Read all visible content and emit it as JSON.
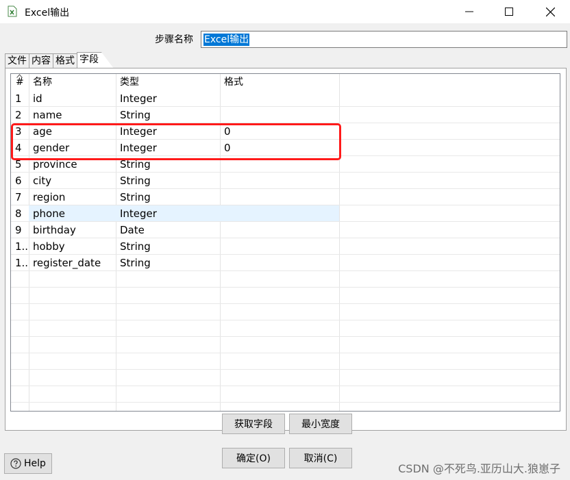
{
  "window": {
    "title": "Excel输出",
    "icon": "excel-file-icon"
  },
  "step": {
    "label": "步骤名称",
    "value": "Excel输出"
  },
  "tabs": [
    {
      "label": "文件"
    },
    {
      "label": "内容"
    },
    {
      "label": "格式"
    },
    {
      "label": "字段"
    }
  ],
  "table": {
    "headers": {
      "num": "#",
      "name": "名称",
      "type": "类型",
      "format": "格式"
    },
    "rows": [
      {
        "num": "1",
        "name": "id",
        "type": "Integer",
        "format": ""
      },
      {
        "num": "2",
        "name": "name",
        "type": "String",
        "format": ""
      },
      {
        "num": "3",
        "name": "age",
        "type": "Integer",
        "format": "0"
      },
      {
        "num": "4",
        "name": "gender",
        "type": "Integer",
        "format": "0"
      },
      {
        "num": "5",
        "name": "province",
        "type": "String",
        "format": ""
      },
      {
        "num": "6",
        "name": "city",
        "type": "String",
        "format": ""
      },
      {
        "num": "7",
        "name": "region",
        "type": "String",
        "format": ""
      },
      {
        "num": "8",
        "name": "phone",
        "type": "Integer",
        "format": ""
      },
      {
        "num": "9",
        "name": "birthday",
        "type": "Date",
        "format": ""
      },
      {
        "num": "1..",
        "name": "hobby",
        "type": "String",
        "format": ""
      },
      {
        "num": "1..",
        "name": "register_date",
        "type": "String",
        "format": ""
      }
    ]
  },
  "buttons": {
    "get_fields": "获取字段",
    "min_width": "最小宽度",
    "ok": "确定(O)",
    "cancel": "取消(C)",
    "help": "Help"
  },
  "watermark": "CSDN @不死鸟.亚历山大.狼崽子",
  "colors": {
    "highlight": "#ff1a1a",
    "selection": "#0078d7",
    "selected_row": "#e5f3ff"
  }
}
